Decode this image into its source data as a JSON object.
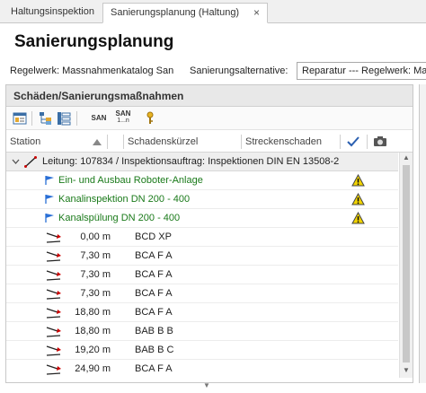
{
  "tabs": [
    {
      "label": "Haltungsinspektion"
    },
    {
      "label": "Sanierungsplanung (Haltung)",
      "close": "×"
    }
  ],
  "page_title": "Sanierungsplanung",
  "regelwerk": "Regelwerk: Massnahmenkatalog San",
  "alternative": {
    "label": "Sanierungsalternative:",
    "value": "Reparatur --- Regelwerk: Ma"
  },
  "panel": {
    "title": "Schäden/Sanierungsmaßnahmen",
    "toolbar": {
      "san": "SAN",
      "san_range_top": "SAN",
      "san_range_bottom": "1...n"
    },
    "columns": {
      "station": "Station",
      "schadenskuerzel": "Schadenskürzel",
      "streckenschaden": "Streckenschaden"
    },
    "group_row": "Leitung: 107834 / Inspektionsauftrag: Inspektionen DIN EN 13508-2",
    "measures": [
      {
        "label": "Ein- und Ausbau Roboter-Anlage"
      },
      {
        "label": "Kanalinspektion DN 200 - 400"
      },
      {
        "label": "Kanalspülung DN 200 - 400"
      }
    ],
    "damages": [
      {
        "station": "0,00 m",
        "code": "BCD XP"
      },
      {
        "station": "7,30 m",
        "code": "BCA F A"
      },
      {
        "station": "7,30 m",
        "code": "BCA F A"
      },
      {
        "station": "7,30 m",
        "code": "BCA F A"
      },
      {
        "station": "18,80 m",
        "code": "BCA F A"
      },
      {
        "station": "18,80 m",
        "code": "BAB B B"
      },
      {
        "station": "19,20 m",
        "code": "BAB B C"
      },
      {
        "station": "24,90 m",
        "code": "BCA F A"
      }
    ]
  },
  "colors": {
    "measure_text": "#1a7a1a",
    "warning": "#f2d400",
    "flag": "#2a6fd6"
  }
}
